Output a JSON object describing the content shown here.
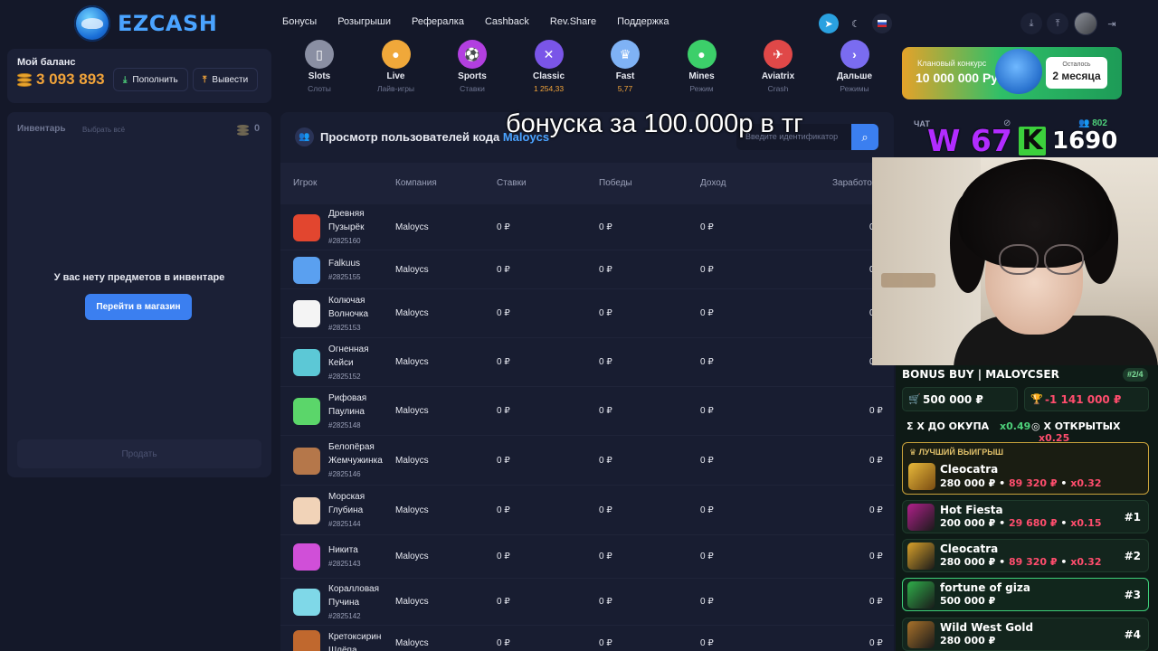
{
  "header": {
    "logo_text": "EZCASH",
    "nav": [
      "Бонусы",
      "Розыгрыши",
      "Рефералка",
      "Cashback",
      "Rev.Share",
      "Поддержка"
    ]
  },
  "balance": {
    "label": "Мой баланс",
    "value": "3 093 893",
    "deposit_label": "Пополнить",
    "withdraw_label": "Вывести"
  },
  "inventory": {
    "title": "Инвентарь",
    "choose_all": "Выбрать всё",
    "count": "0",
    "empty_text": "У вас нету предметов в инвентаре",
    "shop_button": "Перейти в магазин",
    "sell_button": "Продать"
  },
  "games": [
    {
      "name": "Slots",
      "sub": "Слоты",
      "icon": "cards-icon",
      "color": "#8a8fa3",
      "highlight": false
    },
    {
      "name": "Live",
      "sub": "Лайв-игры",
      "icon": "person-icon",
      "color": "#f0a83a",
      "highlight": false
    },
    {
      "name": "Sports",
      "sub": "Ставки",
      "icon": "ball-icon",
      "color": "#b23fe0",
      "highlight": false
    },
    {
      "name": "Classic",
      "sub": "1 254,33",
      "icon": "swords-icon",
      "color": "#7a55e8",
      "highlight": true
    },
    {
      "name": "Fast",
      "sub": "5,77",
      "icon": "crown-icon",
      "color": "#7fb2f5",
      "highlight": true
    },
    {
      "name": "Mines",
      "sub": "Режим",
      "icon": "bomb-icon",
      "color": "#3ccf6a",
      "highlight": false
    },
    {
      "name": "Aviatrix",
      "sub": "Crash",
      "icon": "plane-icon",
      "color": "#e04848",
      "highlight": false
    },
    {
      "name": "Дальше",
      "sub": "Режимы",
      "icon": "arrow-right-icon",
      "color": "#7a6cf0",
      "highlight": false
    }
  ],
  "promo": {
    "sub": "Клановый конкурс",
    "main": "10 000 000 Руб",
    "box_label": "Осталось",
    "box_value": "2 месяца"
  },
  "table": {
    "title": "Просмотр пользователей кода",
    "code": "Maloycs",
    "search_placeholder": "Введите идентификатор",
    "columns": [
      "Игрок",
      "Компания",
      "Ставки",
      "Победы",
      "Доход",
      "Заработок"
    ],
    "rows": [
      {
        "name": "Древняя Пузырёк",
        "id": "#2825160",
        "company": "Maloycs",
        "bets": "0 ₽",
        "wins": "0 ₽",
        "income": "0 ₽",
        "earn": "0",
        "avatar": "#e2462f"
      },
      {
        "name": "Falkuus",
        "id": "#2825155",
        "company": "Maloycs",
        "bets": "0 ₽",
        "wins": "0 ₽",
        "income": "0 ₽",
        "earn": "0",
        "avatar": "#5aa0f0"
      },
      {
        "name": "Колючая Волночка",
        "id": "#2825153",
        "company": "Maloycs",
        "bets": "0 ₽",
        "wins": "0 ₽",
        "income": "0 ₽",
        "earn": "0",
        "avatar": "#f4f4f4"
      },
      {
        "name": "Огненная Кейси",
        "id": "#2825152",
        "company": "Maloycs",
        "bets": "0 ₽",
        "wins": "0 ₽",
        "income": "0 ₽",
        "earn": "0",
        "avatar": "#5cc8d6"
      },
      {
        "name": "Рифовая Паулина",
        "id": "#2825148",
        "company": "Maloycs",
        "bets": "0 ₽",
        "wins": "0 ₽",
        "income": "0 ₽",
        "earn": "0 ₽",
        "avatar": "#5bd66a"
      },
      {
        "name": "Белопёрая Жемчужинка",
        "id": "#2825146",
        "company": "Maloycs",
        "bets": "0 ₽",
        "wins": "0 ₽",
        "income": "0 ₽",
        "earn": "0 ₽",
        "avatar": "#b5774a"
      },
      {
        "name": "Морская Глубина",
        "id": "#2825144",
        "company": "Maloycs",
        "bets": "0 ₽",
        "wins": "0 ₽",
        "income": "0 ₽",
        "earn": "0 ₽",
        "avatar": "#f1d3b8"
      },
      {
        "name": "Никита",
        "id": "#2825143",
        "company": "Maloycs",
        "bets": "0 ₽",
        "wins": "0 ₽",
        "income": "0 ₽",
        "earn": "0 ₽",
        "avatar": "#d04fd8"
      },
      {
        "name": "Коралловая Пучина",
        "id": "#2825142",
        "company": "Maloycs",
        "bets": "0 ₽",
        "wins": "0 ₽",
        "income": "0 ₽",
        "earn": "0 ₽",
        "avatar": "#7fd8e8"
      },
      {
        "name": "Кретоксирин Шлёпа",
        "id": "",
        "company": "Maloycs",
        "bets": "0 ₽",
        "wins": "0 ₽",
        "income": "0 ₽",
        "earn": "0 ₽",
        "avatar": "#c0682e"
      }
    ]
  },
  "overlay": {
    "caption": "бонуска за 100.000р в тг",
    "chat_label": "ЧАТ",
    "viewers": "802",
    "w_score": "W 67",
    "k_letter": "K",
    "k_score": "1690"
  },
  "bonus_buy": {
    "title": "BONUS BUY | MALOYCSER",
    "page": "#2/4",
    "spent": "500 000 ₽",
    "profit": "-1 141 000 ₽",
    "x_to_payback_label": "Х ДО ОКУПА",
    "x_to_payback": "x0.49",
    "x_opened_label": "Х ОТКРЫТЫХ",
    "x_opened": "x0.25",
    "best_label": "ЛУЧШИЙ ВЫИГРЫШ",
    "best": {
      "name": "Cleocatra",
      "bet": "280 000 ₽",
      "win": "89 320 ₽",
      "x": "x0.32"
    },
    "items": [
      {
        "name": "Hot Fiesta",
        "bet": "200 000 ₽",
        "win": "29 680 ₽",
        "x": "x0.15",
        "num": "#1",
        "current": false,
        "color": "#b0208a"
      },
      {
        "name": "Cleocatra",
        "bet": "280 000 ₽",
        "win": "89 320 ₽",
        "x": "x0.32",
        "num": "#2",
        "current": false,
        "color": "#d8a12a"
      },
      {
        "name": "fortune of giza",
        "bet": "500 000 ₽",
        "win": "",
        "x": "",
        "num": "#3",
        "current": true,
        "color": "#2fae4a"
      },
      {
        "name": "Wild West Gold",
        "bet": "280 000 ₽",
        "win": "",
        "x": "",
        "num": "#4",
        "current": false,
        "color": "#a8712a"
      }
    ]
  }
}
